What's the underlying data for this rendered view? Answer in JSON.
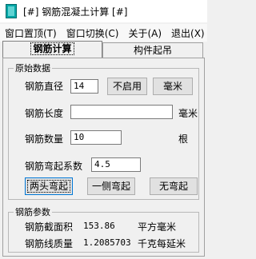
{
  "window": {
    "title": "[#] 钢筋混凝土计算 [#]"
  },
  "menu": [
    {
      "label": "窗口置顶(T)"
    },
    {
      "label": "窗口切换(C)"
    },
    {
      "label": "关于(A)"
    },
    {
      "label": "退出(X)"
    }
  ],
  "tabs": [
    {
      "label": "钢筋计算",
      "active": true
    },
    {
      "label": "构件起吊",
      "active": false
    }
  ],
  "original": {
    "legend": "原始数据",
    "diameter_label": "钢筋直径",
    "diameter_value": "14",
    "disable_button": "不启用",
    "unit_button": "毫米",
    "length_label": "钢筋长度",
    "length_value": "",
    "length_unit": "毫米",
    "count_label": "钢筋数量",
    "count_value": "10",
    "count_unit": "根",
    "bend_label": "钢筋弯起系数",
    "bend_value": "4.5",
    "buttons": {
      "both": "两头弯起",
      "one": "一侧弯起",
      "none": "无弯起"
    }
  },
  "params": {
    "legend": "钢筋参数",
    "area_label": "钢筋截面积",
    "area_value": "153.86",
    "area_unit": "平方毫米",
    "mass_label": "钢筋线质量",
    "mass_value": "1.2085703",
    "mass_unit": "千克每延米"
  }
}
